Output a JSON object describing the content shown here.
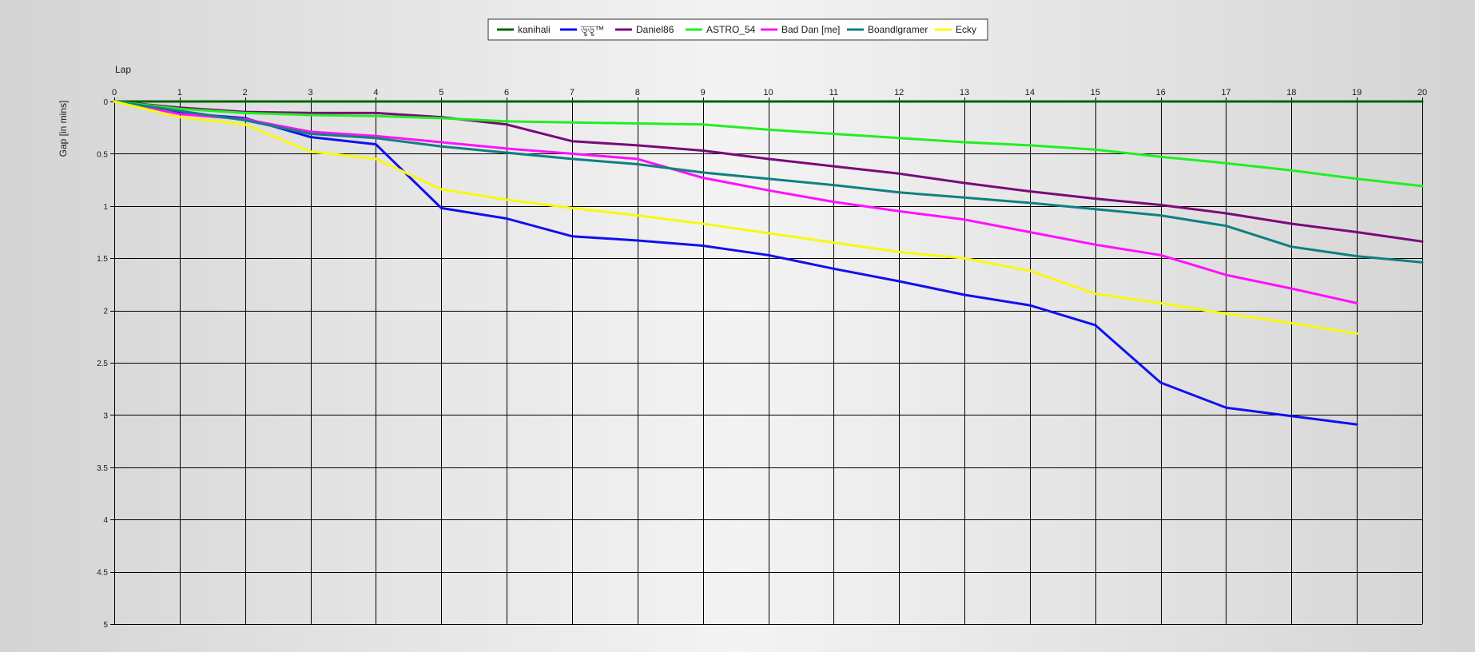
{
  "chart_data": {
    "type": "line",
    "xlabel": "Lap",
    "ylabel": "Gap [in mins]",
    "x_ticks": [
      0,
      1,
      2,
      3,
      4,
      5,
      6,
      7,
      8,
      9,
      10,
      11,
      12,
      13,
      14,
      15,
      16,
      17,
      18,
      19,
      20
    ],
    "y_ticks": [
      0,
      0.5,
      1,
      1.5,
      2,
      2.5,
      3,
      3.5,
      4,
      4.5,
      5
    ],
    "xlim": [
      0,
      20
    ],
    "ylim": [
      0,
      5
    ],
    "y_inverted": true,
    "grid": true,
    "legend_position": "top-center",
    "series": [
      {
        "name": "kanihali",
        "color": "#006400",
        "x": [
          0,
          1,
          2,
          3,
          4,
          5,
          6,
          7,
          8,
          9,
          10,
          11,
          12,
          13,
          14,
          15,
          16,
          17,
          18,
          19,
          20
        ],
        "values": [
          0,
          0,
          0,
          0,
          0,
          0,
          0,
          0,
          0,
          0,
          0,
          0,
          0,
          0,
          0,
          0,
          0,
          0,
          0,
          0,
          0
        ]
      },
      {
        "name": "ড়ৢড়ৢ™",
        "color": "#1010f0",
        "x": [
          0,
          1,
          2,
          3,
          4,
          5,
          6,
          7,
          8,
          9,
          10,
          11,
          12,
          13,
          14,
          15,
          16,
          17,
          18,
          19
        ],
        "values": [
          0,
          0.11,
          0.16,
          0.34,
          0.41,
          1.02,
          1.12,
          1.29,
          1.33,
          1.38,
          1.47,
          1.6,
          1.72,
          1.85,
          1.95,
          2.14,
          2.69,
          2.93,
          3.01,
          3.09
        ]
      },
      {
        "name": "Daniel86",
        "color": "#7a0a7a",
        "x": [
          0,
          1,
          2,
          3,
          4,
          5,
          6,
          7,
          8,
          9,
          10,
          11,
          12,
          13,
          14,
          15,
          16,
          17,
          18,
          19,
          20
        ],
        "values": [
          0,
          0.06,
          0.1,
          0.11,
          0.11,
          0.15,
          0.22,
          0.38,
          0.42,
          0.47,
          0.55,
          0.62,
          0.69,
          0.78,
          0.86,
          0.93,
          0.99,
          1.07,
          1.17,
          1.25,
          1.34
        ]
      },
      {
        "name": "ASTRO_54",
        "color": "#22ee22",
        "x": [
          0,
          1,
          2,
          3,
          4,
          5,
          6,
          7,
          8,
          9,
          10,
          11,
          12,
          13,
          14,
          15,
          16,
          17,
          18,
          19,
          20
        ],
        "values": [
          0,
          0.07,
          0.11,
          0.13,
          0.14,
          0.16,
          0.19,
          0.2,
          0.21,
          0.22,
          0.27,
          0.31,
          0.35,
          0.39,
          0.42,
          0.46,
          0.53,
          0.59,
          0.66,
          0.74,
          0.81
        ]
      },
      {
        "name": "Bad Dan [me]",
        "color": "#ff10ff",
        "x": [
          0,
          1,
          2,
          3,
          4,
          5,
          6,
          7,
          8,
          9,
          10,
          11,
          12,
          13,
          14,
          15,
          16,
          17,
          18,
          19
        ],
        "values": [
          0,
          0.12,
          0.17,
          0.29,
          0.33,
          0.39,
          0.45,
          0.5,
          0.55,
          0.73,
          0.85,
          0.96,
          1.05,
          1.13,
          1.25,
          1.37,
          1.47,
          1.66,
          1.79,
          1.93
        ]
      },
      {
        "name": "Boandlgramer",
        "color": "#108080",
        "x": [
          0,
          1,
          2,
          3,
          4,
          5,
          6,
          7,
          8,
          9,
          10,
          11,
          12,
          13,
          14,
          15,
          16,
          17,
          18,
          19,
          20
        ],
        "values": [
          0,
          0.09,
          0.18,
          0.31,
          0.35,
          0.43,
          0.49,
          0.55,
          0.6,
          0.68,
          0.74,
          0.8,
          0.87,
          0.92,
          0.97,
          1.03,
          1.09,
          1.19,
          1.39,
          1.48,
          1.54
        ]
      },
      {
        "name": "Ecky",
        "color": "#f8f810",
        "x": [
          0,
          1,
          2,
          3,
          4,
          5,
          6,
          7,
          8,
          9,
          10,
          11,
          12,
          13,
          14,
          15,
          16,
          17,
          18,
          19
        ],
        "values": [
          0,
          0.15,
          0.22,
          0.48,
          0.55,
          0.84,
          0.94,
          1.02,
          1.09,
          1.17,
          1.26,
          1.35,
          1.44,
          1.5,
          1.62,
          1.84,
          1.93,
          2.03,
          2.12,
          2.22
        ]
      }
    ]
  }
}
